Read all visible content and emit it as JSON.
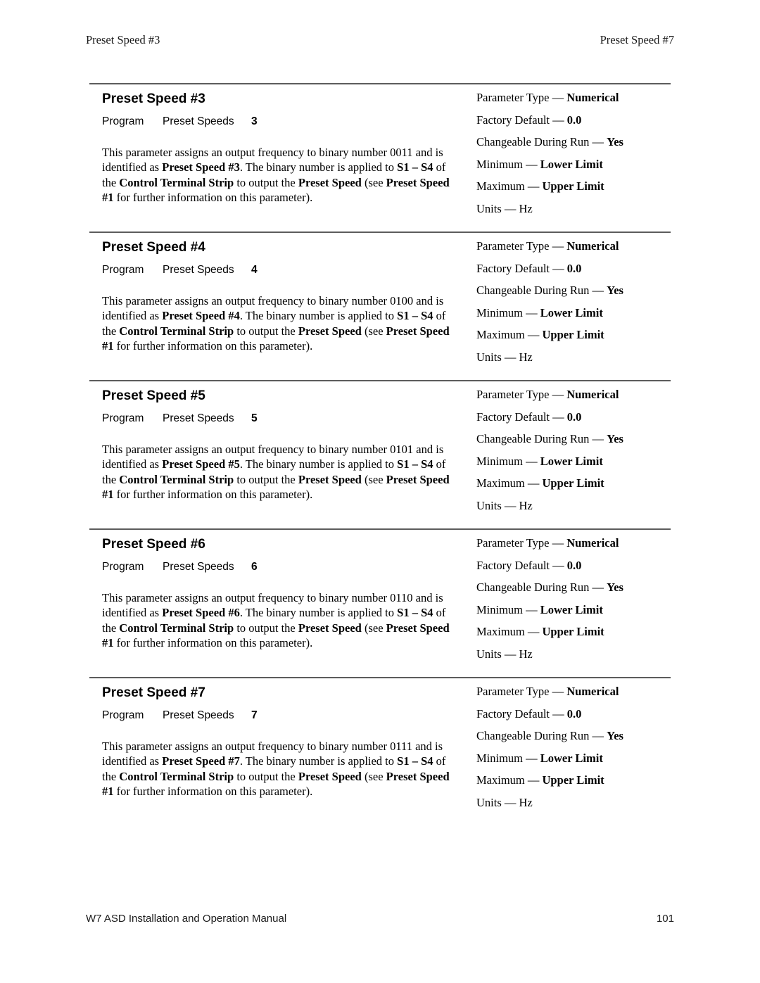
{
  "document": {
    "running_head": {
      "left": "Preset Speed #3",
      "right": "Preset Speed #7"
    },
    "footer": {
      "manual_title": "W7 ASD Installation and Operation Manual",
      "page_number": "101"
    }
  },
  "labels": {
    "menu_root": "Program",
    "menu_group": "Preset Speeds",
    "parameter_type_label": "Parameter Type —",
    "factory_default_label": "Factory Default —",
    "changeable_label": "Changeable During Run —",
    "minimum_label": "Minimum —",
    "maximum_label": "Maximum —",
    "units_label": "Units —"
  },
  "sections": [
    {
      "title": "Preset Speed #3",
      "menu_root": "Program",
      "menu_group": "Preset Speeds",
      "menu_number": "3",
      "description": {
        "part1": "This parameter assigns an output frequency to binary number 0011 and is identified as ",
        "b1": "Preset Speed #3",
        "part2": ". The binary number is applied to ",
        "b2": "S1 – S4",
        "part3": " of the ",
        "b3": "Control Terminal Strip",
        "part4": " to output the ",
        "b4": "Preset Speed",
        "part5": " (see ",
        "b5": "Preset Speed #1",
        "part6": " for further information on this parameter)."
      },
      "attributes": {
        "parameter_type": "Numerical",
        "factory_default": "0.0",
        "changeable_during_run": "Yes",
        "minimum": "Lower Limit",
        "maximum": "Upper Limit",
        "units": "Hz"
      }
    },
    {
      "title": "Preset Speed #4",
      "menu_root": "Program",
      "menu_group": "Preset Speeds",
      "menu_number": "4",
      "description": {
        "part1": "This parameter assigns an output frequency to binary number 0100 and is identified as ",
        "b1": "Preset Speed #4",
        "part2": ". The binary number is applied to ",
        "b2": "S1 – S4",
        "part3": " of the ",
        "b3": "Control Terminal Strip",
        "part4": " to output the ",
        "b4": "Preset Speed",
        "part5": " (see ",
        "b5": "Preset Speed #1",
        "part6": " for further information on this parameter)."
      },
      "attributes": {
        "parameter_type": "Numerical",
        "factory_default": "0.0",
        "changeable_during_run": "Yes",
        "minimum": "Lower Limit",
        "maximum": "Upper Limit",
        "units": "Hz"
      }
    },
    {
      "title": "Preset Speed #5",
      "menu_root": "Program",
      "menu_group": "Preset Speeds",
      "menu_number": "5",
      "description": {
        "part1": "This parameter assigns an output frequency to binary number 0101 and is identified as ",
        "b1": "Preset Speed #5",
        "part2": ". The binary number is applied to ",
        "b2": "S1 – S4",
        "part3": " of the ",
        "b3": "Control Terminal Strip",
        "part4": " to output the ",
        "b4": "Preset Speed",
        "part5": " (see ",
        "b5": "Preset Speed #1",
        "part6": " for further information on this parameter)."
      },
      "attributes": {
        "parameter_type": "Numerical",
        "factory_default": "0.0",
        "changeable_during_run": "Yes",
        "minimum": "Lower Limit",
        "maximum": "Upper Limit",
        "units": "Hz"
      }
    },
    {
      "title": "Preset Speed #6",
      "menu_root": "Program",
      "menu_group": "Preset Speeds",
      "menu_number": "6",
      "description": {
        "part1": "This parameter assigns an output frequency to binary number 0110 and is identified as ",
        "b1": "Preset Speed #6",
        "part2": ". The binary number is applied to ",
        "b2": "S1 – S4",
        "part3": " of the ",
        "b3": "Control Terminal Strip",
        "part4": " to output the ",
        "b4": "Preset Speed",
        "part5": " (see ",
        "b5": "Preset Speed #1",
        "part6": " for further information on this parameter)."
      },
      "attributes": {
        "parameter_type": "Numerical",
        "factory_default": "0.0",
        "changeable_during_run": "Yes",
        "minimum": "Lower Limit",
        "maximum": "Upper Limit",
        "units": "Hz"
      }
    },
    {
      "title": "Preset Speed #7",
      "menu_root": "Program",
      "menu_group": "Preset Speeds",
      "menu_number": "7",
      "description": {
        "part1": "This parameter assigns an output frequency to binary number 0111 and is identified as ",
        "b1": "Preset Speed #7",
        "part2": ". The binary number is applied to ",
        "b2": "S1 – S4",
        "part3": " of the ",
        "b3": "Control Terminal Strip",
        "part4": " to output the ",
        "b4": "Preset Speed",
        "part5": " (see ",
        "b5": "Preset Speed #1",
        "part6": " for further information on this parameter)."
      },
      "attributes": {
        "parameter_type": "Numerical",
        "factory_default": "0.0",
        "changeable_during_run": "Yes",
        "minimum": "Lower Limit",
        "maximum": "Upper Limit",
        "units": "Hz"
      }
    }
  ]
}
